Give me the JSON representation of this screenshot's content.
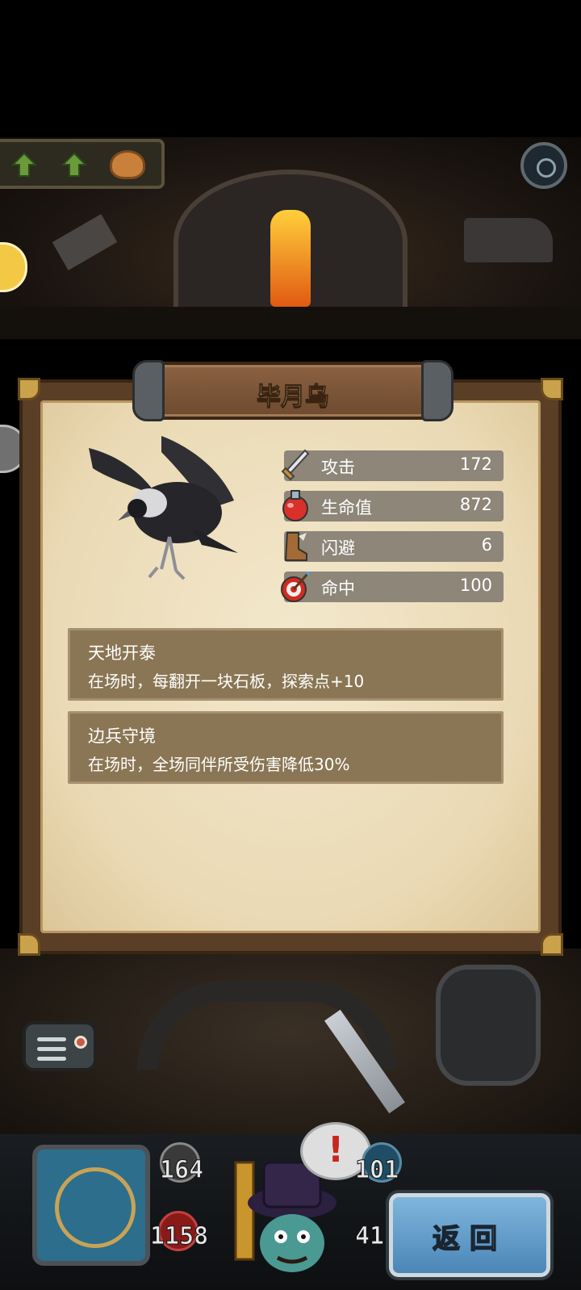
{
  "unit": {
    "name": "毕月乌",
    "stats": [
      {
        "label": "攻击",
        "value": "172",
        "icon": "sword-icon"
      },
      {
        "label": "生命值",
        "value": "872",
        "icon": "potion-icon"
      },
      {
        "label": "闪避",
        "value": "6",
        "icon": "boot-icon"
      },
      {
        "label": "命中",
        "value": "100",
        "icon": "target-icon"
      }
    ],
    "skills": [
      {
        "name": "天地开泰",
        "description": "在场时，每翻开一块石板，探索点+10"
      },
      {
        "name": "边兵守境",
        "description": "在场时，全场同伴所受伤害降低30%"
      }
    ]
  },
  "hud": {
    "attack_value": "164",
    "hp_value": "1158",
    "right_top_value": "101",
    "right_bottom_value": "41",
    "alert_mark": "!",
    "back_label": "返回"
  },
  "colors": {
    "parchment": "#ead9b4",
    "stat_bar": "#8d8679",
    "skill_bar": "#8a7654",
    "title_text": "#f6e7a6",
    "back_button": "#5f9ccb"
  }
}
